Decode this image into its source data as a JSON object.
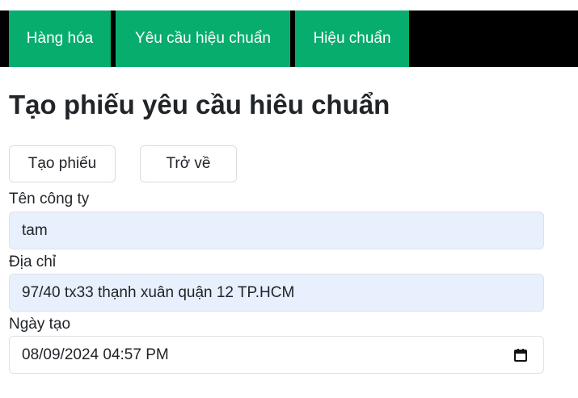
{
  "nav": {
    "items": [
      {
        "label": "Hàng hóa"
      },
      {
        "label": "Yêu cầu hiệu chuẩn"
      },
      {
        "label": "Hiệu chuẩn"
      }
    ]
  },
  "page": {
    "title": "Tạo phiếu yêu cầu hiêu chuẩn"
  },
  "actions": {
    "create_label": "Tạo phiếu",
    "back_label": "Trở về"
  },
  "form": {
    "company": {
      "label": "Tên công ty",
      "value": "tam"
    },
    "address": {
      "label": "Địa chỉ",
      "value": "97/40 tx33 thạnh xuân quận 12 TP.HCM"
    },
    "date": {
      "label": "Ngày tạo",
      "value": "08/09/2024 04:57 PM",
      "icon": "calendar-icon"
    }
  },
  "colors": {
    "nav_accent": "#07ad6c",
    "nav_background": "#000000",
    "autofill_background": "#e8f0fe"
  }
}
